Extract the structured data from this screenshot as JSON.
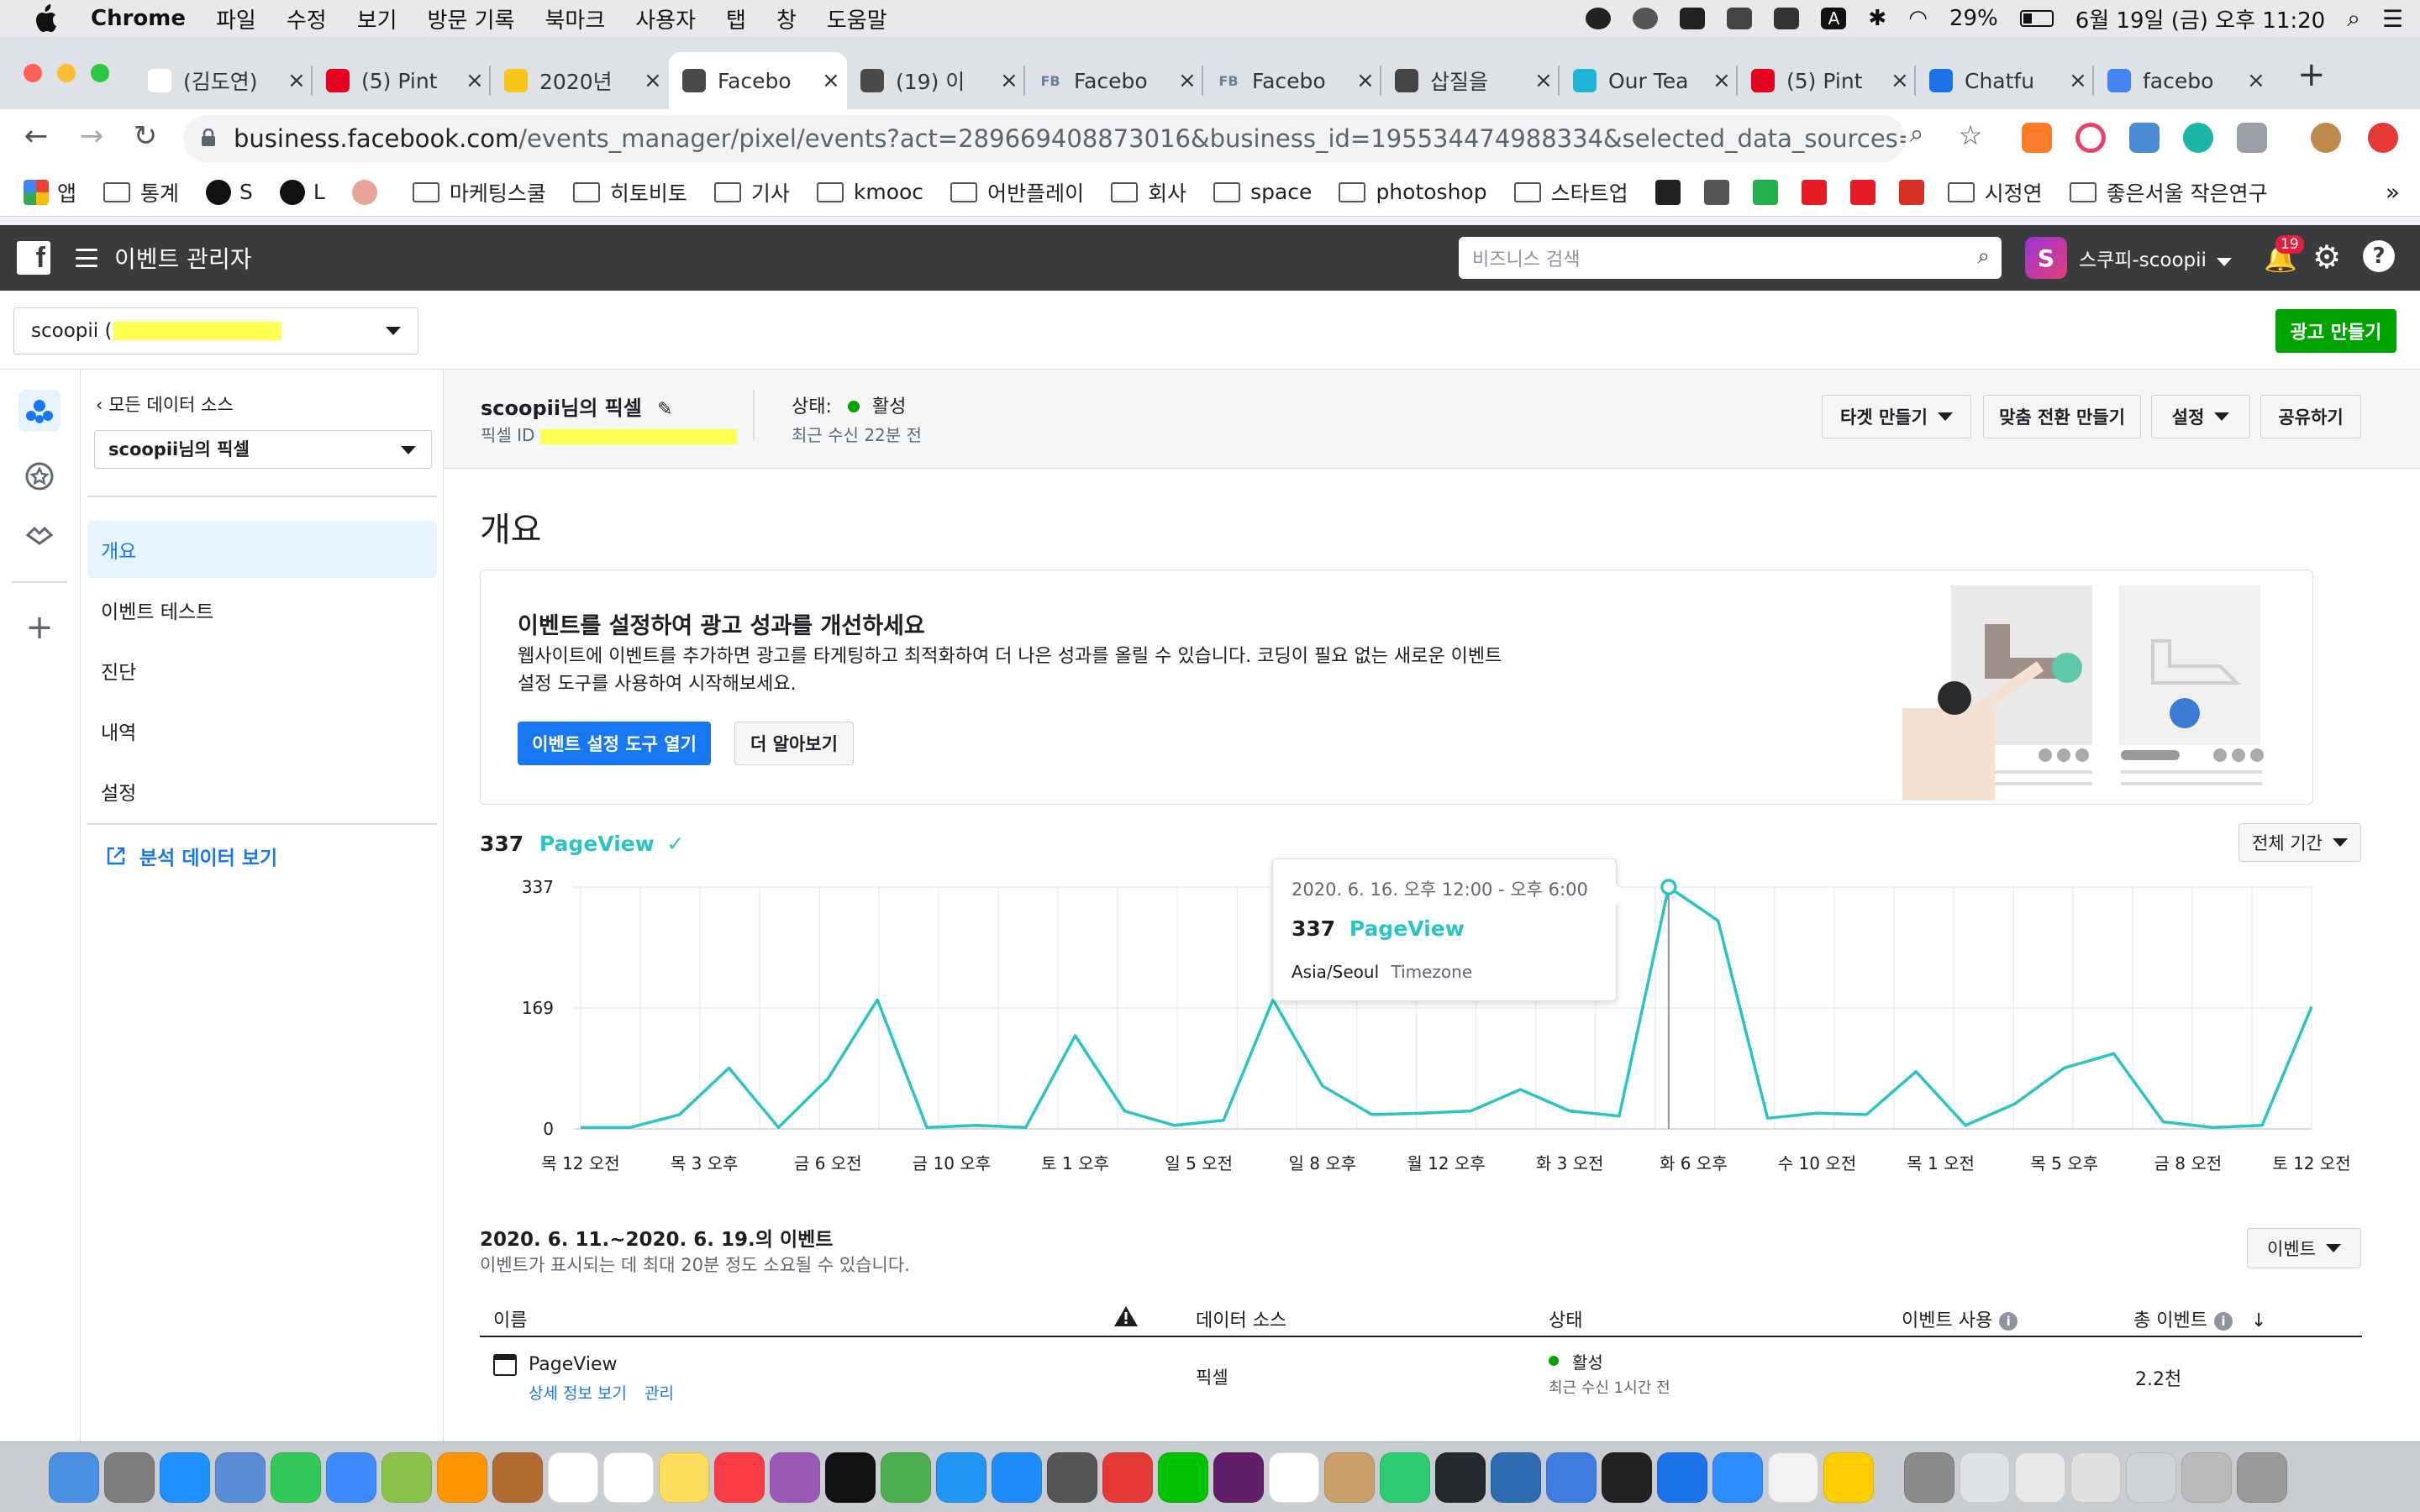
{
  "menubar": {
    "app_name": "Chrome",
    "items": [
      "파일",
      "수정",
      "보기",
      "방문 기록",
      "북마크",
      "사용자",
      "탭",
      "창",
      "도움말"
    ],
    "battery": "29%",
    "datetime": "6월 19일 (금) 오후 11:20"
  },
  "tabs": [
    {
      "title": "(김도연)",
      "active": false,
      "color": "#ffffff"
    },
    {
      "title": "(5) Pint",
      "active": false,
      "color": "#e60023"
    },
    {
      "title": "2020년",
      "active": false,
      "color": "#f5c518"
    },
    {
      "title": "Facebo",
      "active": true,
      "color": "#4a4a4a"
    },
    {
      "title": "(19) 이",
      "active": false,
      "color": "#4a4a4a"
    },
    {
      "title": "Facebo",
      "active": false,
      "color": "#6a7f9a",
      "prefix": "FB"
    },
    {
      "title": "Facebo",
      "active": false,
      "color": "#6a7f9a",
      "prefix": "FB"
    },
    {
      "title": "삽질을 ",
      "active": false,
      "color": "#444444"
    },
    {
      "title": "Our Tea",
      "active": false,
      "color": "#1fb6d6"
    },
    {
      "title": "(5) Pint",
      "active": false,
      "color": "#e60023"
    },
    {
      "title": "Chatfu",
      "active": false,
      "color": "#1a73e8"
    },
    {
      "title": "facebo",
      "active": false,
      "color": "#4285f4"
    }
  ],
  "address": {
    "host": "business.facebook.com",
    "path": "/events_manager/pixel/events?act=289669408873016&business_id=195534474988334&selected_data_sources=ALL&se..."
  },
  "bookmarks": [
    {
      "label": "앱",
      "type": "apps"
    },
    {
      "label": "통계",
      "type": "folder"
    },
    {
      "label": "S",
      "type": "site"
    },
    {
      "label": "L",
      "type": "site"
    },
    {
      "label": "",
      "type": "site"
    },
    {
      "label": "마케팅스쿨",
      "type": "folder"
    },
    {
      "label": "히토비토",
      "type": "folder"
    },
    {
      "label": "기사",
      "type": "folder"
    },
    {
      "label": "kmooc",
      "type": "folder"
    },
    {
      "label": "어반플레이",
      "type": "folder"
    },
    {
      "label": "회사",
      "type": "folder"
    },
    {
      "label": "space",
      "type": "folder"
    },
    {
      "label": "photoshop",
      "type": "folder"
    },
    {
      "label": "스타트업",
      "type": "folder"
    },
    {
      "label": "시정연",
      "type": "folder"
    },
    {
      "label": "좋은서울 작은연구",
      "type": "folder"
    }
  ],
  "fb_header": {
    "title": "이벤트 관리자",
    "search_placeholder": "비즈니스 검색",
    "account_name": "스쿠피-scoopii",
    "notification_count": "19"
  },
  "business": {
    "selector_label": "scoopii (",
    "create_ad_button": "광고 만들기"
  },
  "sidenav": {
    "back_label": "모든 데이터 소스",
    "source_dropdown": "scoopii님의 픽셀",
    "items": [
      "개요",
      "이벤트 테스트",
      "진단",
      "내역",
      "설정"
    ],
    "analytics_link": "분석 데이터 보기"
  },
  "pixel_header": {
    "name": "scoopii님의 픽셀",
    "id_label": "픽셀 ID",
    "status_label": "상태:",
    "status_value": "활성",
    "last_received": "최근 수신 22분 전",
    "buttons": [
      "타겟 만들기",
      "맞춤 전환 만들기",
      "설정",
      "공유하기"
    ]
  },
  "overview": {
    "title": "개요",
    "promo_title": "이벤트를 설정하여 광고 성과를 개선하세요",
    "promo_body_1": "웹사이트에 이벤트를 추가하면 광고를 타게팅하고 최적화하여 더 나은 성과를 올릴 수 있습니다. 코딩이 필요 없는 새로운 이벤트",
    "promo_body_2": "설정 도구를 사용하여 시작해보세요.",
    "promo_primary_btn": "이벤트 설정 도구 열기",
    "promo_secondary_btn": "더 알아보기"
  },
  "chart_summary": {
    "count": "337",
    "event_name": "PageView",
    "range_dropdown": "전체 기간"
  },
  "chart_data": {
    "type": "line",
    "series": [
      {
        "name": "PageView",
        "values": [
          2,
          2,
          20,
          85,
          2,
          70,
          180,
          2,
          5,
          2,
          130,
          25,
          5,
          12,
          180,
          60,
          20,
          22,
          25,
          55,
          25,
          18,
          337,
          290,
          15,
          22,
          20,
          80,
          5,
          35,
          85,
          105,
          10,
          2,
          5,
          170
        ]
      }
    ],
    "x_tick_labels": [
      "목 12 오전",
      "목 3 오후",
      "금 6 오전",
      "금 10 오후",
      "토 1 오후",
      "일 5 오전",
      "일 8 오후",
      "월 12 오후",
      "화 3 오전",
      "화 6 오후",
      "수 10 오전",
      "목 1 오전",
      "목 5 오후",
      "금 8 오전",
      "토 12 오전"
    ],
    "y_tick_labels": [
      "337",
      "169",
      "0"
    ],
    "ylim": [
      0,
      337
    ],
    "highlight_index": 22,
    "color": "#2bc4c4"
  },
  "tooltip": {
    "time_range": "2020. 6. 16. 오후 12:00 - 오후 6:00",
    "value": "337",
    "event": "PageView",
    "timezone": "Asia/Seoul",
    "timezone_label": "Timezone"
  },
  "events_section": {
    "title": "2020. 6. 11.~2020. 6. 19.의 이벤트",
    "subtitle": "이벤트가 표시되는 데 최대 20분 정도 소요될 수 있습니다.",
    "filter_dropdown": "이벤트",
    "columns": [
      "이름",
      "데이터 소스",
      "상태",
      "이벤트 사용",
      "총 이벤트"
    ],
    "rows": [
      {
        "name": "PageView",
        "detail_link": "상세 정보 보기",
        "manage_link": "관리",
        "source": "픽셀",
        "status": "활성",
        "status_sub": "최근 수신 1시간 전",
        "total": "2.2천"
      }
    ]
  },
  "colors": {
    "accent_blue": "#1877f2",
    "teal": "#2bc4c4",
    "green": "#00a400"
  }
}
